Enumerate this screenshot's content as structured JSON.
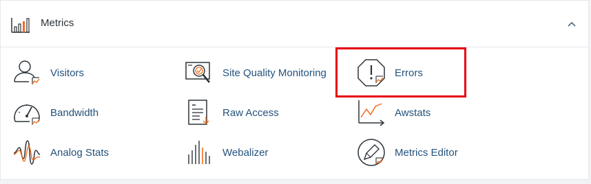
{
  "header": {
    "title": "Metrics",
    "icon": "bar-chart-icon",
    "collapse_icon": "chevron-up-icon"
  },
  "items": [
    {
      "label": "Visitors",
      "icon": "visitors-icon"
    },
    {
      "label": "Site Quality Monitoring",
      "icon": "site-quality-icon"
    },
    {
      "label": "Errors",
      "icon": "errors-icon"
    },
    {
      "label": "Bandwidth",
      "icon": "speedometer-icon"
    },
    {
      "label": "Raw Access",
      "icon": "document-icon"
    },
    {
      "label": "Awstats",
      "icon": "line-chart-icon"
    },
    {
      "label": "Analog Stats",
      "icon": "waveform-icon"
    },
    {
      "label": "Webalizer",
      "icon": "bars-icon"
    },
    {
      "label": "Metrics Editor",
      "icon": "metrics-editor-icon"
    }
  ],
  "colors": {
    "accent": "#f26b1d",
    "icon_stroke": "#2c3339",
    "link": "#23527c",
    "highlight": "#e8000b"
  }
}
